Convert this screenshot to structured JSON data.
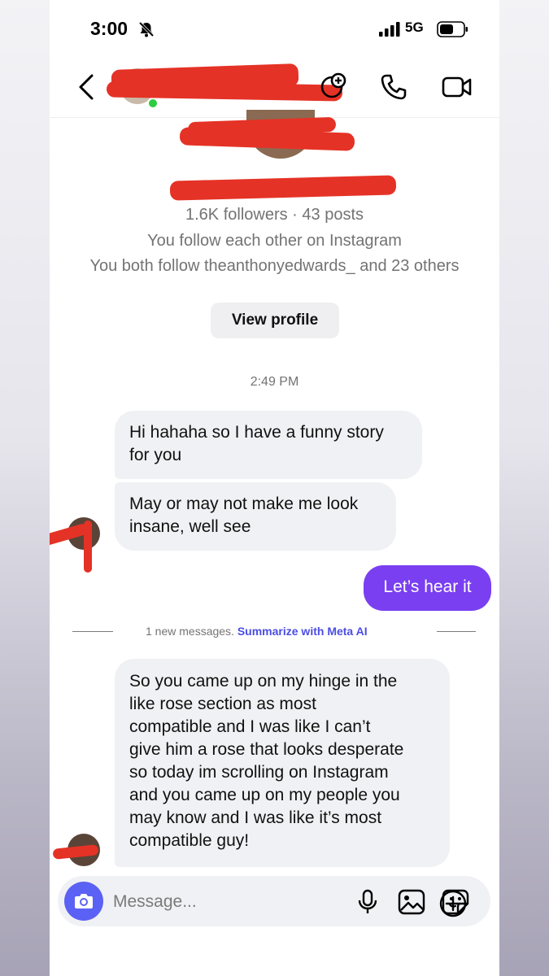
{
  "status_bar": {
    "time": "3:00",
    "network": "5G"
  },
  "profile": {
    "stats": "1.6K followers · 43 posts",
    "mutual": "You follow each other on Instagram",
    "mutual_follows": "You both follow theanthonyedwards_ and 23 others",
    "view_profile_label": "View profile"
  },
  "conversation": {
    "timestamp": "2:49 PM",
    "msg1": [
      "Hi hahaha so I have a funny story",
      "for you"
    ],
    "msg2": [
      "May or may not make me look",
      "insane, well see"
    ],
    "reply": "Let’s hear it",
    "new_messages_text": "1 new messages.",
    "summarize_label": "Summarize with Meta AI",
    "msg3": [
      "So you came up on my hinge in the",
      "like rose section as most",
      "compatible and I was like I can’t",
      "give him a rose that looks desperate",
      "so today im scrolling on Instagram",
      "and you came up on my people you",
      "may know and I was like it’s most",
      "compatible guy!"
    ]
  },
  "composer": {
    "placeholder": "Message..."
  },
  "colors": {
    "accent": "#7a3ff0",
    "camera": "#5b61f4",
    "link": "#4b4de3",
    "redaction": "#e53226"
  },
  "icons": [
    "bell-off-icon",
    "signal-icon",
    "battery-icon",
    "back-icon",
    "add-effect-icon",
    "phone-icon",
    "video-icon",
    "camera-icon",
    "microphone-icon",
    "gallery-icon",
    "sticker-icon",
    "plus-icon"
  ]
}
